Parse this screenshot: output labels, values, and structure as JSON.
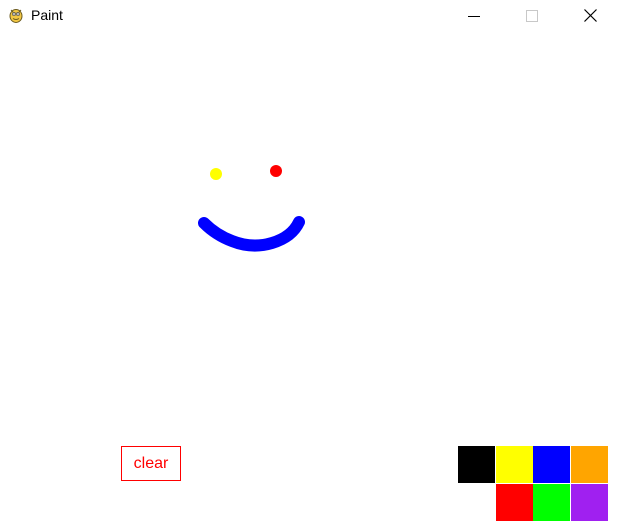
{
  "window": {
    "title": "Paint"
  },
  "toolbar": {
    "clear_label": "clear"
  },
  "palette": {
    "colors": [
      "#000000",
      "#ffff00",
      "#0000ff",
      "#ffa500",
      "#ff0000",
      "#00ff00",
      "#a020f0"
    ]
  },
  "drawing": {
    "stroke_colors": [
      "#ffff00",
      "#ff0000",
      "#0000ff"
    ]
  }
}
